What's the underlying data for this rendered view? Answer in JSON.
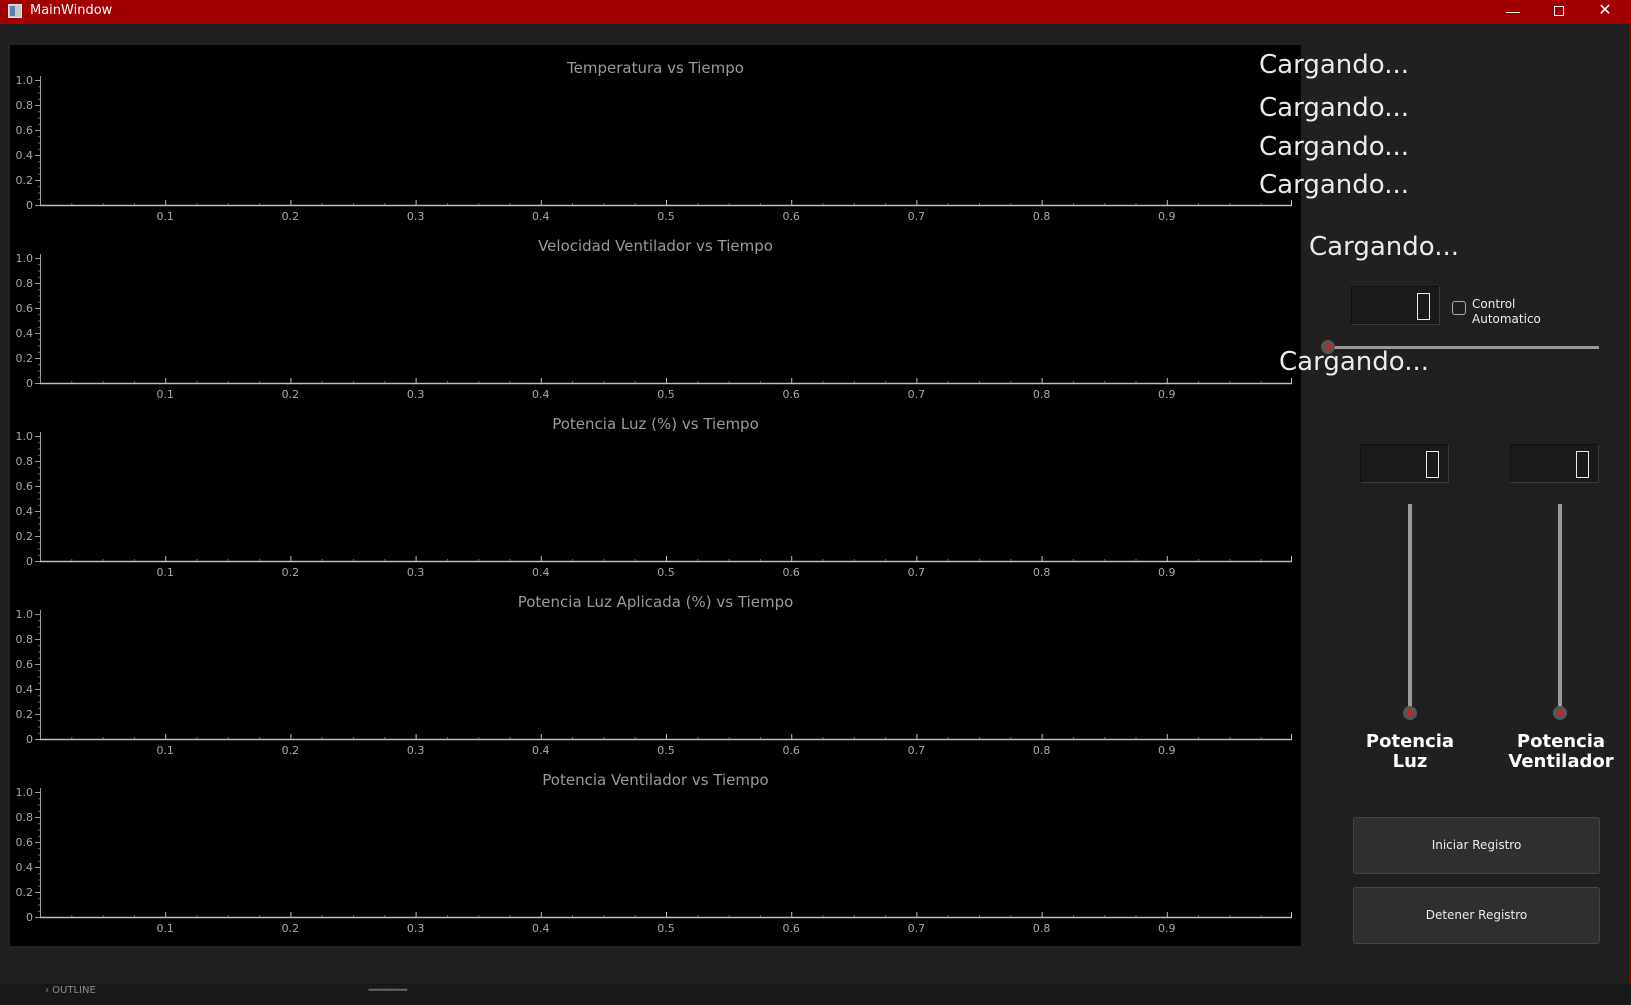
{
  "window": {
    "title": "MainWindow",
    "minimize_glyph": "—",
    "close_glyph": "✕"
  },
  "plots": [
    {
      "title": "Temperatura vs Tiempo"
    },
    {
      "title": "Velocidad Ventilador vs Tiempo"
    },
    {
      "title": "Potencia Luz (%) vs Tiempo"
    },
    {
      "title": "Potencia Luz Aplicada (%) vs Tiempo"
    },
    {
      "title": "Potencia Ventilador vs Tiempo"
    }
  ],
  "chart_data": [
    {
      "type": "line",
      "title": "Temperatura vs Tiempo",
      "series": [],
      "xlim": [
        0,
        1
      ],
      "ylim": [
        0,
        1.0
      ],
      "x_ticks": [
        "0.1",
        "0.2",
        "0.3",
        "0.4",
        "0.5",
        "0.6",
        "0.7",
        "0.8",
        "0.9"
      ],
      "y_ticks": [
        "0",
        "0.2",
        "0.4",
        "0.6",
        "0.8",
        "1.0"
      ]
    },
    {
      "type": "line",
      "title": "Velocidad Ventilador vs Tiempo",
      "series": [],
      "xlim": [
        0,
        1
      ],
      "ylim": [
        0,
        1.0
      ],
      "x_ticks": [
        "0.1",
        "0.2",
        "0.3",
        "0.4",
        "0.5",
        "0.6",
        "0.7",
        "0.8",
        "0.9"
      ],
      "y_ticks": [
        "0",
        "0.2",
        "0.4",
        "0.6",
        "0.8",
        "1.0"
      ]
    },
    {
      "type": "line",
      "title": "Potencia Luz (%) vs Tiempo",
      "series": [],
      "xlim": [
        0,
        1
      ],
      "ylim": [
        0,
        1.0
      ],
      "x_ticks": [
        "0.1",
        "0.2",
        "0.3",
        "0.4",
        "0.5",
        "0.6",
        "0.7",
        "0.8",
        "0.9"
      ],
      "y_ticks": [
        "0",
        "0.2",
        "0.4",
        "0.6",
        "0.8",
        "1.0"
      ]
    },
    {
      "type": "line",
      "title": "Potencia Luz Aplicada (%) vs Tiempo",
      "series": [],
      "xlim": [
        0,
        1
      ],
      "ylim": [
        0,
        1.0
      ],
      "x_ticks": [
        "0.1",
        "0.2",
        "0.3",
        "0.4",
        "0.5",
        "0.6",
        "0.7",
        "0.8",
        "0.9"
      ],
      "y_ticks": [
        "0",
        "0.2",
        "0.4",
        "0.6",
        "0.8",
        "1.0"
      ]
    },
    {
      "type": "line",
      "title": "Potencia Ventilador vs Tiempo",
      "series": [],
      "xlim": [
        0,
        1
      ],
      "ylim": [
        0,
        1.0
      ],
      "x_ticks": [
        "0.1",
        "0.2",
        "0.3",
        "0.4",
        "0.5",
        "0.6",
        "0.7",
        "0.8",
        "0.9"
      ],
      "y_ticks": [
        "0",
        "0.2",
        "0.4",
        "0.6",
        "0.8",
        "1.0"
      ]
    }
  ],
  "status": {
    "line1": "Cargando...",
    "line2": "Cargando...",
    "line3": "Cargando...",
    "line4": "Cargando...",
    "setpoint_label": "Cargando...",
    "control_label": "Cargando..."
  },
  "setpoint": {
    "display": "0",
    "slider_level": 0
  },
  "auto_control": {
    "label": "Control Automatico",
    "checked": false
  },
  "luz": {
    "display": "0",
    "slider_level": 0,
    "label": "Potencia Luz"
  },
  "ventilador": {
    "display": "0",
    "slider_level": 0,
    "label": "Potencia Ventilador"
  },
  "buttons": {
    "start": "Iniciar Registro",
    "stop": "Detener Registro"
  },
  "taskbar": {
    "outline": "› OUTLINE"
  },
  "colors": {
    "titlebar": "#a00000",
    "plot_bg": "#000000",
    "slider_handle": "#d42020"
  }
}
